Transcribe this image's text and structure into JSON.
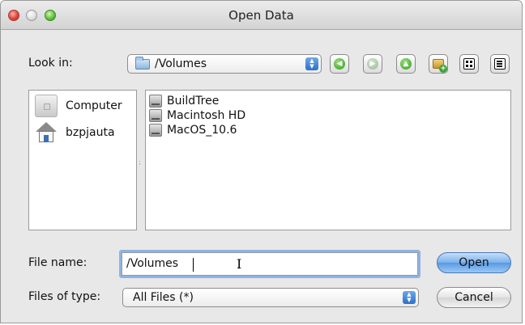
{
  "window": {
    "title": "Open Data"
  },
  "lookin": {
    "label": "Look in:",
    "value": "/Volumes"
  },
  "toolbar": {
    "buttons": [
      "back-icon",
      "forward-icon",
      "up-folder-icon",
      "new-folder-icon",
      "list-view-icon",
      "details-view-icon"
    ]
  },
  "sidebar": {
    "items": [
      {
        "label": "Computer",
        "icon": "computer-icon"
      },
      {
        "label": "bzpjauta",
        "icon": "home-icon"
      }
    ]
  },
  "files": {
    "items": [
      {
        "label": "BuildTree",
        "icon": "disk-icon"
      },
      {
        "label": "Macintosh HD",
        "icon": "disk-icon"
      },
      {
        "label": "MacOS_10.6",
        "icon": "disk-icon"
      }
    ]
  },
  "filename": {
    "label": "File name:",
    "value": "/Volumes"
  },
  "filetype": {
    "label": "Files of type:",
    "value": "All Files (*)"
  },
  "buttons": {
    "open": "Open",
    "cancel": "Cancel"
  },
  "colors": {
    "accent": "#5899e3",
    "focus_ring": "#8db3e6"
  }
}
